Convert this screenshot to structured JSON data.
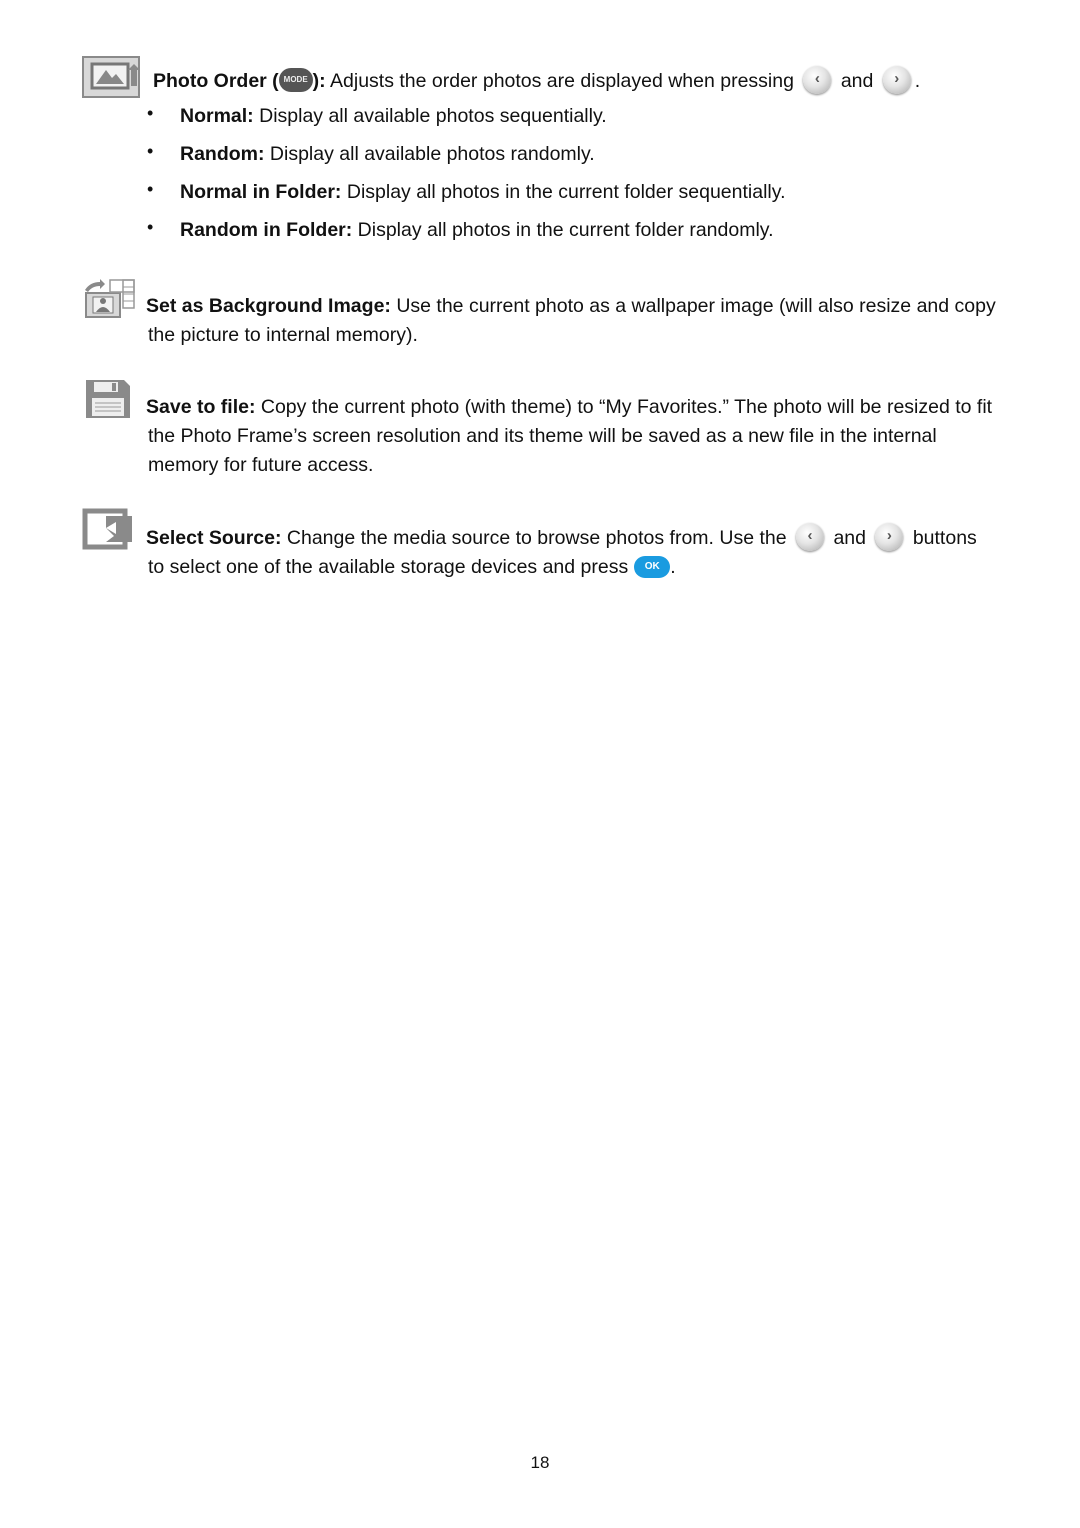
{
  "photo_order": {
    "title": "Photo Order (",
    "mode_label": "MODE",
    "title_close": "):",
    "text": " Adjusts the order photos are displayed when pressing",
    "and": "and",
    "period": ".",
    "options": [
      {
        "label": "Normal:",
        "desc": " Display all available photos sequentially."
      },
      {
        "label": "Random:",
        "desc": " Display all available photos randomly."
      },
      {
        "label": "Normal in Folder:",
        "desc": " Display all photos in the current folder sequentially."
      },
      {
        "label": "Random in Folder:",
        "desc": " Display all photos in the current folder randomly."
      }
    ]
  },
  "background": {
    "title": "Set as Background Image:",
    "line1": " Use the current photo as a wallpaper image (will also resize and copy",
    "line2": "the picture to internal memory)."
  },
  "save": {
    "title": "Save to file:",
    "line1": " Copy the current photo (with theme) to “My Favorites.” The photo will be resized to fit",
    "line2": "the Photo Frame’s screen resolution and its theme will be saved as a new file in the internal",
    "line3": "memory for future access."
  },
  "source": {
    "title": "Select Source:",
    "line1": " Change the media source to browse photos from. Use the",
    "and": "and",
    "buttons": "buttons",
    "line2": "to select one of the available storage devices and press",
    "ok_label": "OK",
    "period": "."
  },
  "bullet_char": "•",
  "page_number": "18"
}
